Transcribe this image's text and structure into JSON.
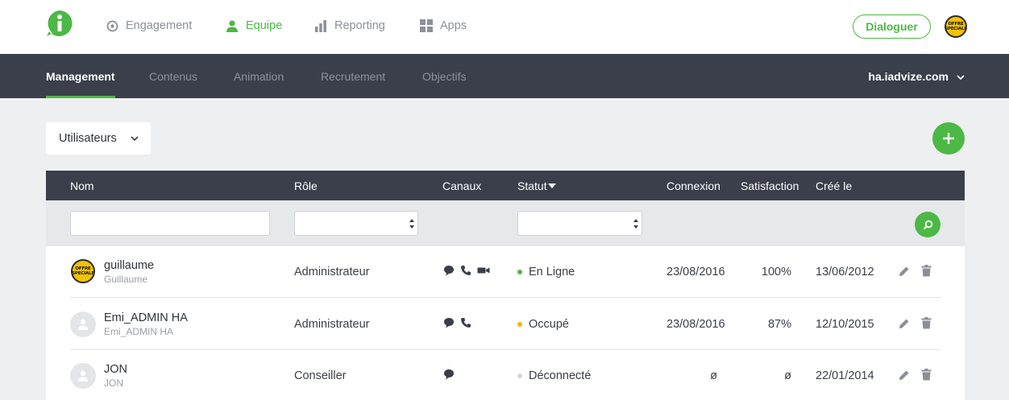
{
  "topnav": {
    "items": [
      {
        "label": "Engagement",
        "icon": "target-icon",
        "active": false
      },
      {
        "label": "Equipe",
        "icon": "person-icon",
        "active": true
      },
      {
        "label": "Reporting",
        "icon": "bar-chart-icon",
        "active": false
      },
      {
        "label": "Apps",
        "icon": "grid-icon",
        "active": false
      }
    ],
    "dialoguer_label": "Dialoguer",
    "badge_text": "OFFRE SPECIALE"
  },
  "subnav": {
    "tabs": [
      "Management",
      "Contenus",
      "Animation",
      "Recrutement",
      "Objectifs"
    ],
    "active_tab": "Management",
    "domain": "ha.iadvize.com"
  },
  "controls": {
    "entity_select": "Utilisateurs"
  },
  "table": {
    "headers": {
      "name": "Nom",
      "role": "Rôle",
      "channels": "Canaux",
      "status": "Statut",
      "login": "Connexion",
      "satisfaction": "Satisfaction",
      "created": "Créé le"
    },
    "rows": [
      {
        "name": "guillaume",
        "login": "Guillaume",
        "avatar": "badge",
        "role": "Administrateur",
        "channels": [
          "chat-icon",
          "phone-icon",
          "video-icon"
        ],
        "status": "En Ligne",
        "status_color": "#4cb845",
        "last_login": "23/08/2016",
        "satisfaction": "100%",
        "created": "13/06/2012"
      },
      {
        "name": "Emi_ADMIN HA",
        "login": "Emi_ADMIN HA",
        "avatar": "default",
        "role": "Administrateur",
        "channels": [
          "chat-icon",
          "phone-icon"
        ],
        "status": "Occupé",
        "status_color": "#f5b800",
        "last_login": "23/08/2016",
        "satisfaction": "87%",
        "created": "12/10/2015"
      },
      {
        "name": "JON",
        "login": "JON",
        "avatar": "default",
        "role": "Conseiller",
        "channels": [
          "chat-icon"
        ],
        "status": "Déconnecté",
        "status_color": "#d3d5d8",
        "last_login": "ø",
        "satisfaction": "ø",
        "created": "22/01/2014"
      }
    ]
  },
  "colors": {
    "accent": "#4cb845",
    "dark_bar": "#3a3f4b",
    "background": "#eeeff0"
  }
}
